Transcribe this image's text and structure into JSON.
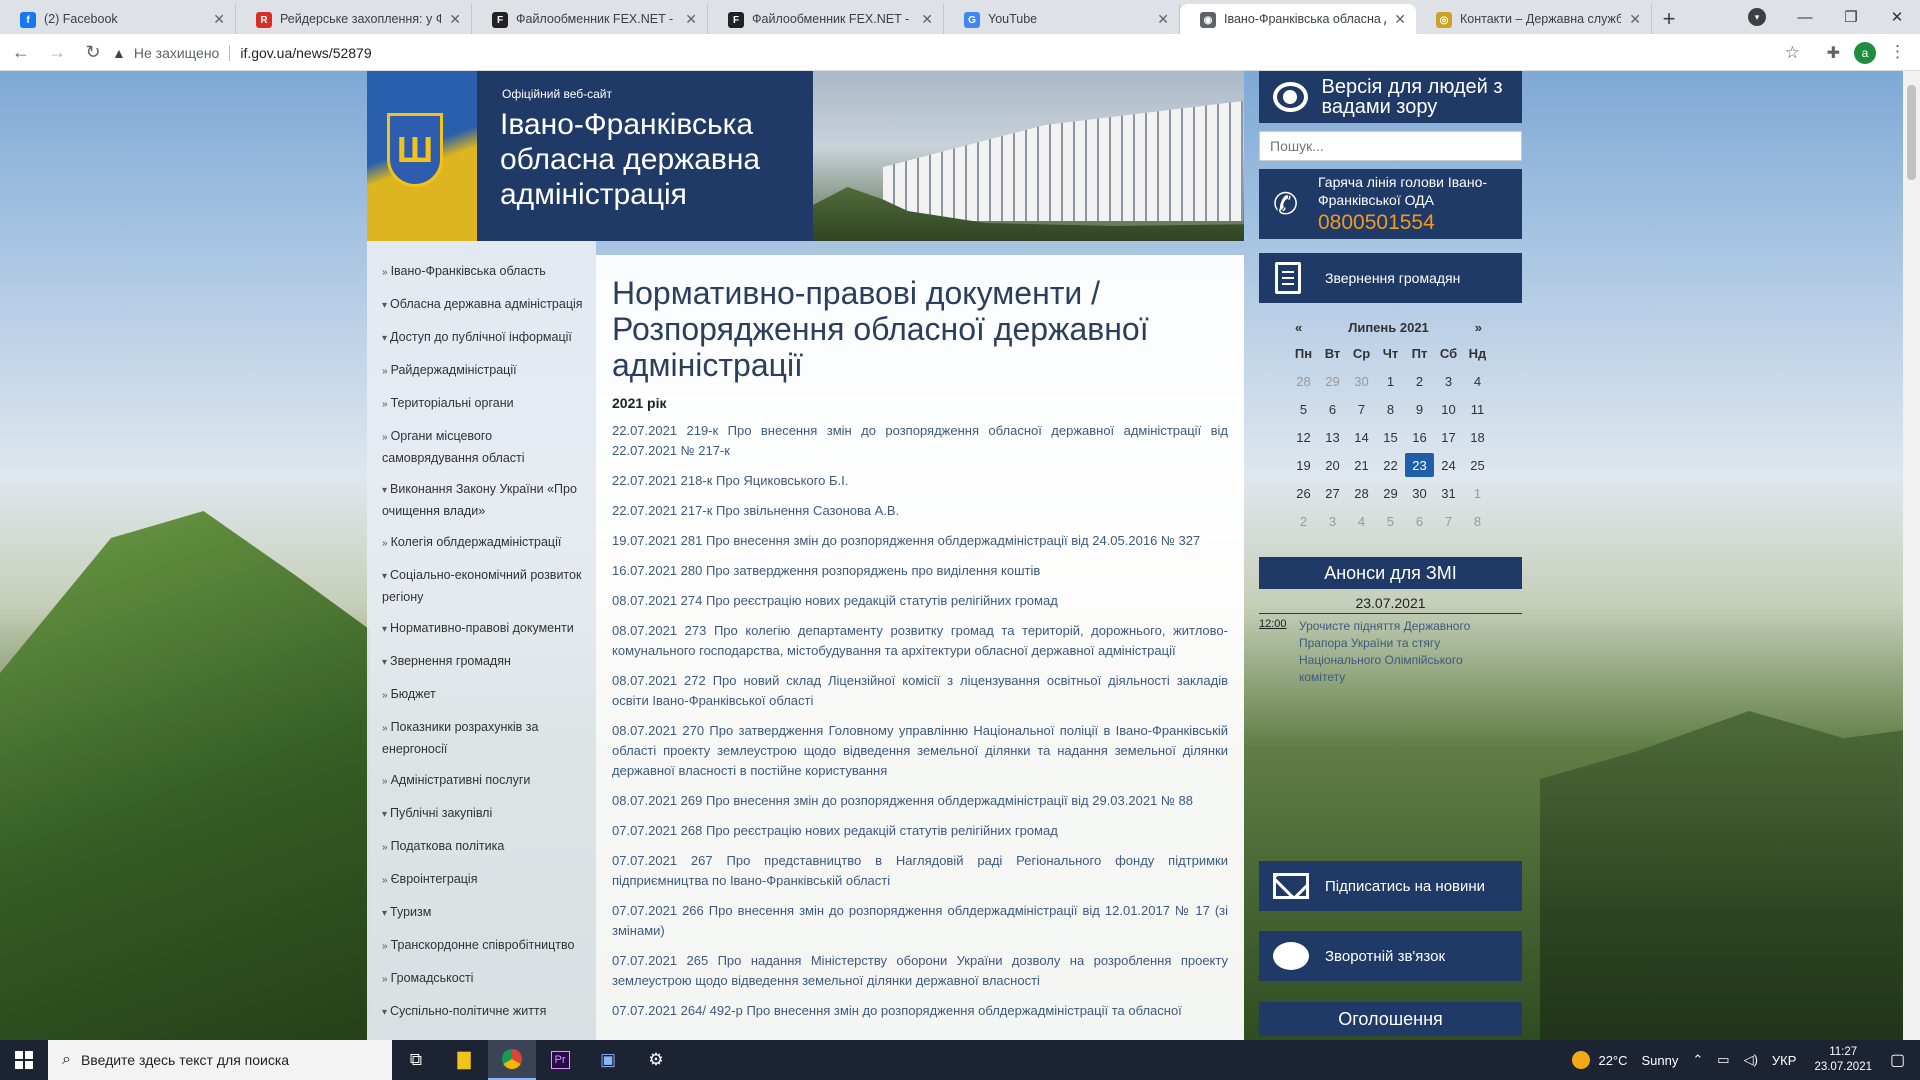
{
  "browser": {
    "tabs": [
      {
        "title": "(2) Facebook",
        "icon": "facebook-icon",
        "color": "#1877f2",
        "glyph": "f"
      },
      {
        "title": "Рейдерське захоплення: у Фра",
        "icon": "pdf-icon",
        "color": "#d93025",
        "glyph": "R"
      },
      {
        "title": "Файлообменник FEX.NET - Хра",
        "icon": "fex-icon",
        "color": "#222222",
        "glyph": "F"
      },
      {
        "title": "Файлообменник FEX.NET - Хра",
        "icon": "fex-icon",
        "color": "#222222",
        "glyph": "F"
      },
      {
        "title": "YouTube",
        "icon": "google-icon",
        "color": "#4285f4",
        "glyph": "G"
      },
      {
        "title": "Івано-Франківська обласна де",
        "icon": "globe-icon",
        "color": "#5f6368",
        "glyph": "◉"
      },
      {
        "title": "Контакти – Державна служба У",
        "icon": "seal-icon",
        "color": "#c9a227",
        "glyph": "◎"
      }
    ],
    "active_tab": 5,
    "new_tab_label": "+",
    "security_label": "Не захищено",
    "url": "if.gov.ua/news/52879",
    "profile_initial": "a"
  },
  "site": {
    "official_label": "Офіційний веб-сайт",
    "org_name": "Івано-Франківська обласна державна адміністрація",
    "vision_label": "Версія для людей з вадами зору",
    "search_placeholder": "Пошук...",
    "hotline_label": "Гаряча лінія голови Івано-Франківської ОДА",
    "hotline_number": "0800501554",
    "appeal_label": "Звернення громадян",
    "subscribe_label": "Підписатись на новини",
    "feedback_label": "Зворотній зв'язок",
    "announcements_label": "Оголошення"
  },
  "left_menu": [
    {
      "marker": "»",
      "label": "Івано-Франківська область"
    },
    {
      "marker": "▾",
      "label": "Обласна державна адміністрація"
    },
    {
      "marker": "▾",
      "label": "Доступ до публічної інформації"
    },
    {
      "marker": "»",
      "label": "Райдержадміністрації"
    },
    {
      "marker": "»",
      "label": "Територіальні органи"
    },
    {
      "marker": "»",
      "label": "Органи місцевого самоврядування області"
    },
    {
      "marker": "▾",
      "label": "Виконання Закону України «Про очищення влади»"
    },
    {
      "marker": "»",
      "label": "Колегія облдержадміністрації"
    },
    {
      "marker": "▾",
      "label": "Соціально-економічний розвиток регіону"
    },
    {
      "marker": "▾",
      "label": "Нормативно-правові документи"
    },
    {
      "marker": "▾",
      "label": "Звернення громадян"
    },
    {
      "marker": "»",
      "label": "Бюджет"
    },
    {
      "marker": "»",
      "label": "Показники розрахунків за енергоносії"
    },
    {
      "marker": "»",
      "label": "Адміністративні послуги"
    },
    {
      "marker": "▾",
      "label": "Публічні закупівлі"
    },
    {
      "marker": "»",
      "label": "Податкова політика"
    },
    {
      "marker": "»",
      "label": "Євроінтеграція"
    },
    {
      "marker": "▾",
      "label": "Туризм"
    },
    {
      "marker": "»",
      "label": "Транскордонне співробітництво"
    },
    {
      "marker": "»",
      "label": "Громадськості"
    },
    {
      "marker": "▾",
      "label": "Суспільно-політичне життя"
    }
  ],
  "main": {
    "title": "Нормативно-правові документи / Розпорядження обласної державної адміністрації",
    "year_label": "2021 рік",
    "documents": [
      "22.07.2021  219-к Про внесення змін до розпорядження обласної державної адміністрації від 22.07.2021 № 217-к",
      "22.07.2021  218-к Про Яциковського Б.І.",
      "22.07.2021  217-к Про звільнення Сазонова А.В.",
      "19.07.2021  281 Про внесення змін до розпорядження облдержадміністрації від 24.05.2016 № 327",
      "16.07.2021  280 Про затвердження розпоряджень про виділення коштів",
      "08.07.2021  274 Про реєстрацію нових редакцій статутів релігійних громад",
      "08.07.2021  273 Про колегію департаменту розвитку громад та територій, дорожнього, житлово-комунального господарства, містобудування та архітектури обласної державної адміністрації",
      "08.07.2021  272 Про новий склад Ліцензійної комісії з ліцензування освітньої діяльності закладів освіти Івано-Франківської області",
      "08.07.2021   270 Про затвердження Головному управлінню Національної поліції в Івано-Франківській області проекту землеустрою щодо відведення земельної ділянки та надання земельної ділянки державної власності в постійне користування",
      "08.07.2021  269 Про внесення змін до розпорядження облдержадміністрації від 29.03.2021 № 88",
      "07.07.2021  268 Про реєстрацію нових редакцій статутів релігійних громад",
      "07.07.2021   267 Про представництво в Наглядовій раді Регіонального фонду підтримки підприємництва по Івано-Франківській області",
      "07.07.2021  266 Про внесення змін до розпорядження облдержадміністрації від 12.01.2017 № 17 (зі змінами)",
      "07.07.2021  265 Про надання Міністерству оборони України дозволу на розроблення проекту землеустрою щодо відведення земельної ділянки державної власності",
      "07.07.2021  264/ 492-р Про внесення змін до розпорядження облдержадміністрації та обласної"
    ]
  },
  "calendar": {
    "prev": "«",
    "next": "»",
    "month_label": "Липень 2021",
    "weekdays": [
      "Пн",
      "Вт",
      "Ср",
      "Чт",
      "Пт",
      "Сб",
      "Нд"
    ],
    "days": [
      "28",
      "29",
      "30",
      "1",
      "2",
      "3",
      "4",
      "5",
      "6",
      "7",
      "8",
      "9",
      "10",
      "11",
      "12",
      "13",
      "14",
      "15",
      "16",
      "17",
      "18",
      "19",
      "20",
      "21",
      "22",
      "23",
      "24",
      "25",
      "26",
      "27",
      "28",
      "29",
      "30",
      "31",
      "1",
      "2",
      "3",
      "4",
      "5",
      "6",
      "7",
      "8"
    ],
    "first_in_month_index": 3,
    "last_in_month_index": 33,
    "today_index": 25
  },
  "press": {
    "header": "Анонси для ЗМІ",
    "date": "23.07.2021",
    "items": [
      {
        "time": "12:00",
        "text": "Урочисте підняття Державного Прапора України та стягу Національного Олімпійського комітету"
      }
    ]
  },
  "taskbar": {
    "search_placeholder": "Введите здесь текст для поиска",
    "weather_temp": "22°C",
    "weather_text": "Sunny",
    "language": "УКР",
    "time": "11:27",
    "date": "23.07.2021"
  }
}
